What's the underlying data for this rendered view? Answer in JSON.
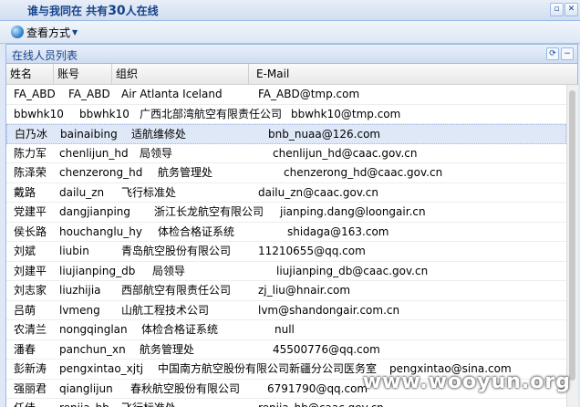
{
  "window": {
    "title_prefix": "谁与我同在 共有",
    "title_count": "30",
    "title_suffix": "人在线"
  },
  "toolbar": {
    "view_label": "查看方式"
  },
  "panel": {
    "title": "在线人员列表"
  },
  "columns": [
    "姓名",
    "账号",
    "组织",
    "E-Mail"
  ],
  "rows": [
    {
      "name": "FA_ABD",
      "account": "FA_ABD",
      "org": "Air Atlanta Iceland",
      "email": "FA_ABD@tmp.com"
    },
    {
      "name": "bbwhk10",
      "account": "bbwhk10",
      "org": "广西北部湾航空有限责任公司",
      "email": "bbwhk10@tmp.com"
    },
    {
      "name": "白乃冰",
      "account": "bainaibing",
      "org": "适航维修处",
      "email": "bnb_nuaa@126.com"
    },
    {
      "name": "陈力军",
      "account": "chenlijun_hd",
      "org": "局领导",
      "email": "chenlijun_hd@caac.gov.cn"
    },
    {
      "name": "陈泽荣",
      "account": "chenzerong_hd",
      "org": "航务管理处",
      "email": "chenzerong_hd@caac.gov.cn"
    },
    {
      "name": "戴路",
      "account": "dailu_zn",
      "org": "飞行标准处",
      "email": "dailu_zn@caac.gov.cn"
    },
    {
      "name": "党建平",
      "account": "dangjianping",
      "org": "浙江长龙航空有限公司",
      "email": "jianping.dang@loongair.cn"
    },
    {
      "name": "侯长路",
      "account": "houchanglu_hy",
      "org": "体检合格证系统",
      "email": "shidaga@163.com"
    },
    {
      "name": "刘斌",
      "account": "liubin",
      "org": "青岛航空股份有限公司",
      "email": "11210655@qq.com"
    },
    {
      "name": "刘建平",
      "account": "liujianping_db",
      "org": "局领导",
      "email": "liujianping_db@caac.gov.cn"
    },
    {
      "name": "刘志家",
      "account": "liuzhijia",
      "org": "西部航空有限责任公司",
      "email": "zj_liu@hnair.com"
    },
    {
      "name": "吕萌",
      "account": "lvmeng",
      "org": "山航工程技术公司",
      "email": "lvm@shandongair.com.cn"
    },
    {
      "name": "农清兰",
      "account": "nongqinglan",
      "org": "体检合格证系统",
      "email": "null"
    },
    {
      "name": "潘春",
      "account": "panchun_xn",
      "org": "航务管理处",
      "email": "45500776@qq.com"
    },
    {
      "name": "彭新涛",
      "account": "pengxintao_xjtj",
      "org": "中国南方航空股份有限公司新疆分公司医务室",
      "email": "pengxintao@sina.com"
    },
    {
      "name": "强丽君",
      "account": "qianglijun",
      "org": "春秋航空股份有限公司",
      "email": "6791790@qq.com"
    },
    {
      "name": "任佳",
      "account": "renjia_hb",
      "org": "飞行标准处",
      "email": "renjia_hb@caac.gov.cn"
    }
  ],
  "watermark": "www.wooyun.org"
}
